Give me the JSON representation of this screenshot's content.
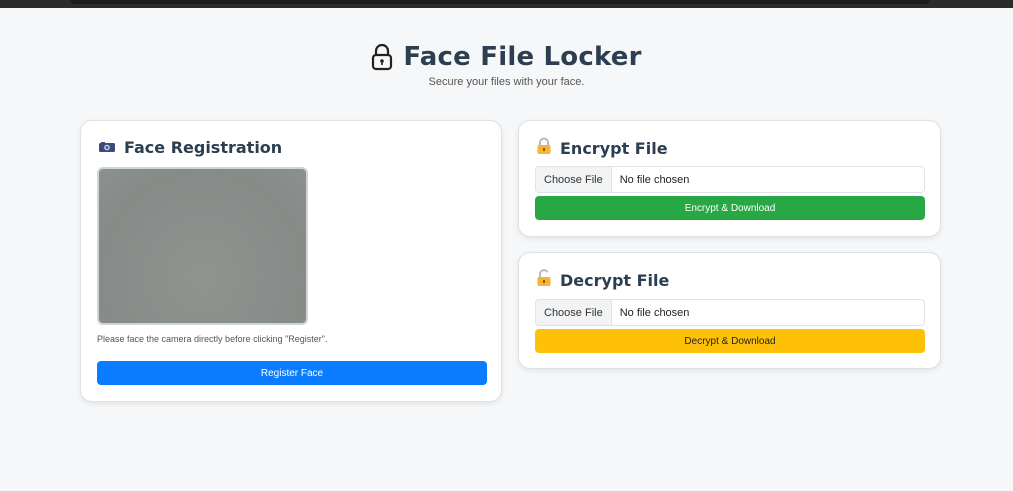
{
  "header": {
    "title": "Face File Locker",
    "subtitle": "Secure your files with your face.",
    "icon": "lock-icon"
  },
  "registration": {
    "title": "Face Registration",
    "icon": "camera-icon",
    "hint": "Please face the camera directly before clicking \"Register\".",
    "button": "Register Face",
    "button_color": "#0a7cff"
  },
  "encrypt": {
    "title": "Encrypt File",
    "icon": "locked-padlock-icon",
    "choose_label": "Choose File",
    "file_status": "No file chosen",
    "button": "Encrypt & Download",
    "button_color": "#28a745"
  },
  "decrypt": {
    "title": "Decrypt File",
    "icon": "unlocked-padlock-icon",
    "choose_label": "Choose File",
    "file_status": "No file chosen",
    "button": "Decrypt & Download",
    "button_color": "#ffc107"
  }
}
